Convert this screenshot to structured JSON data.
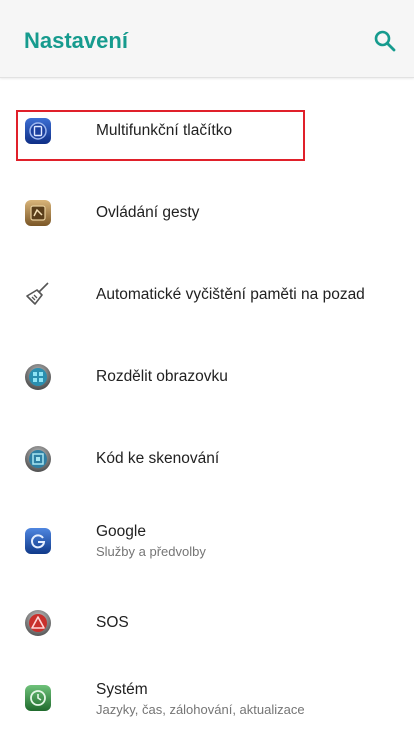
{
  "header": {
    "title": "Nastavení",
    "search_icon": "search-icon",
    "accent_color": "#169b8e"
  },
  "items": [
    {
      "title": "Multifunkční tlačítko",
      "subtitle": "",
      "icon": "multifunction-button-icon"
    },
    {
      "title": "Ovládání gesty",
      "subtitle": "",
      "icon": "gesture-control-icon"
    },
    {
      "title": "Automatické vyčištění paměti na pozad",
      "subtitle": "",
      "icon": "broom-clean-icon"
    },
    {
      "title": "Rozdělit obrazovku",
      "subtitle": "",
      "icon": "split-screen-icon"
    },
    {
      "title": "Kód ke skenování",
      "subtitle": "",
      "icon": "qr-scan-icon"
    },
    {
      "title": "Google",
      "subtitle": "Služby a předvolby",
      "icon": "google-icon"
    },
    {
      "title": "SOS",
      "subtitle": "",
      "icon": "sos-icon"
    },
    {
      "title": "Systém",
      "subtitle": "Jazyky, čas, zálohování, aktualizace",
      "icon": "system-icon"
    }
  ],
  "highlight_color": "#e0202a"
}
